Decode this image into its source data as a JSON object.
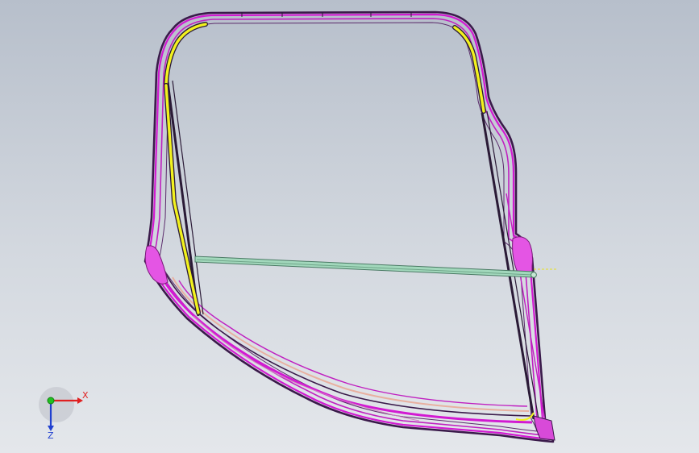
{
  "viewport": {
    "background_top": "#b7bfcb",
    "background_bottom": "#e4e7eb"
  },
  "model": {
    "frame_color": "#d21ad2",
    "frame_dark": "#3a1a4a",
    "seal_color": "#f2f21e",
    "rod_color": "#9ed6b8",
    "bracket_color": "#e455e4"
  },
  "triad": {
    "x_label": "X",
    "z_label": "Z",
    "x_color": "#e02020",
    "y_color": "#20c020",
    "z_color": "#2040d0"
  }
}
